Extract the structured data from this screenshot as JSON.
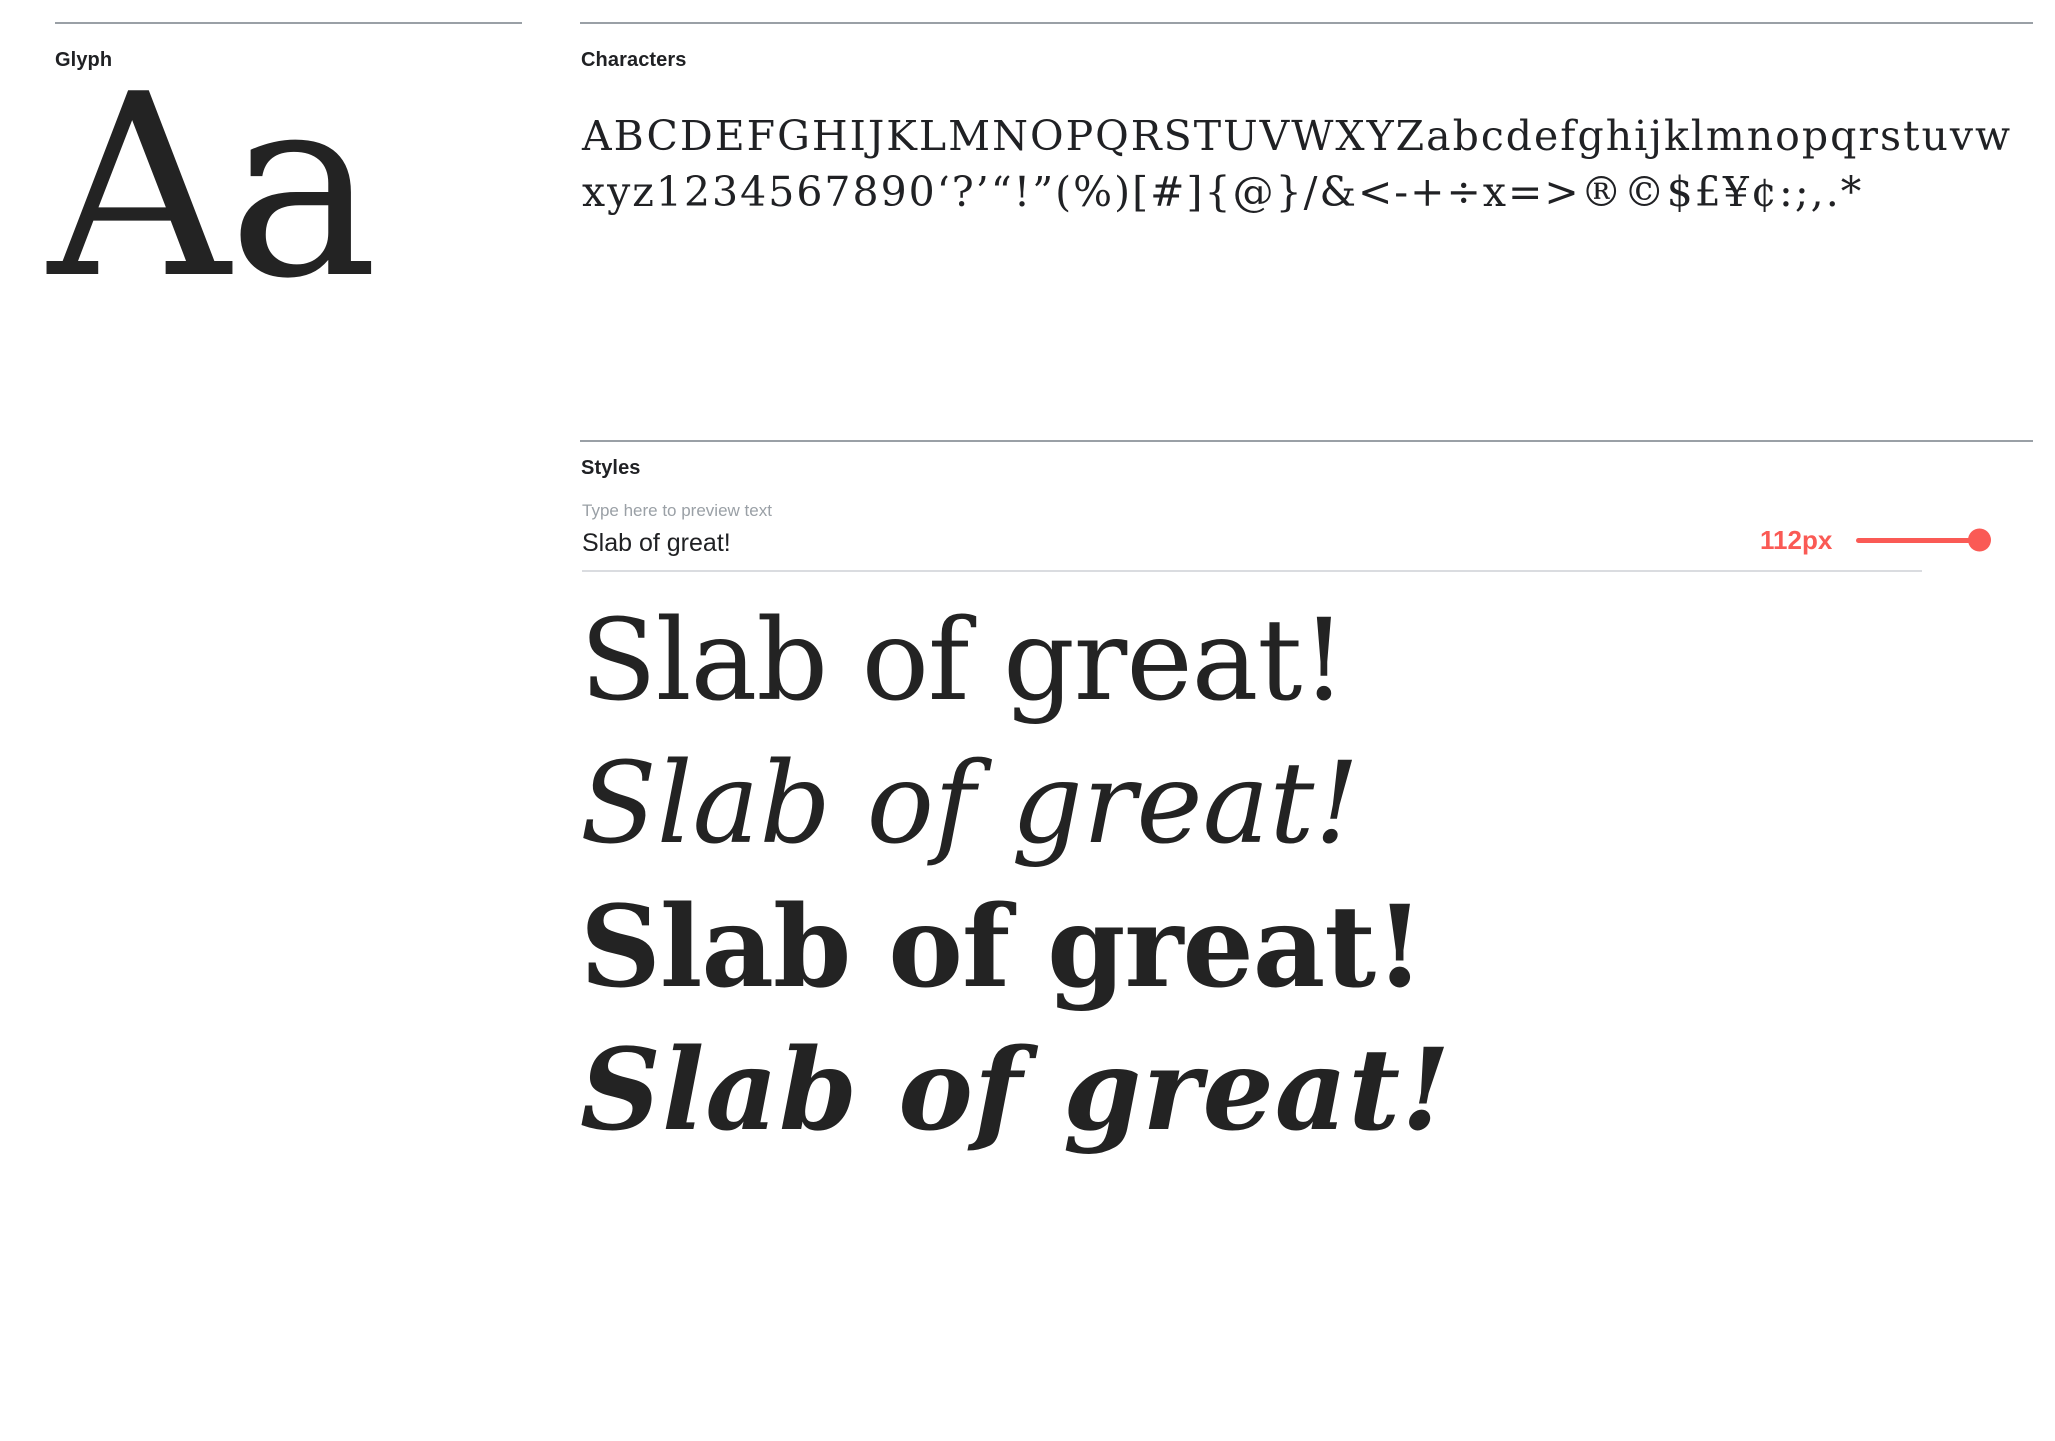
{
  "glyph_section": {
    "label": "Glyph",
    "sample": "Aa"
  },
  "characters_section": {
    "label": "Characters",
    "characters": "ABCDEFGHIJKLMNOPQRSTUVWXYZabcdefghijklmnopqrstuvwxyz1234567890‘?’“!”(%)[#]{@}/&<-+÷x=>®©$£¥¢:;,.*"
  },
  "styles_section": {
    "label": "Styles",
    "preview_input": {
      "placeholder": "Type here to preview text",
      "value": "Slab of great!"
    },
    "size_slider": {
      "value_label": "112px",
      "value": 112,
      "percent": 100,
      "color": "#fa5a55"
    },
    "samples": [
      {
        "text": "Slab of great!",
        "style": "regular"
      },
      {
        "text": "Slab of great!",
        "style": "italic"
      },
      {
        "text": "Slab of great!",
        "style": "bold"
      },
      {
        "text": "Slab of great!",
        "style": "bold-italic"
      }
    ]
  },
  "colors": {
    "text": "#202124",
    "glyph": "#232323",
    "rule": "#9aa0a6",
    "accent": "#fa5a55",
    "placeholder": "#9aa0a6",
    "underline": "#dadce0"
  }
}
